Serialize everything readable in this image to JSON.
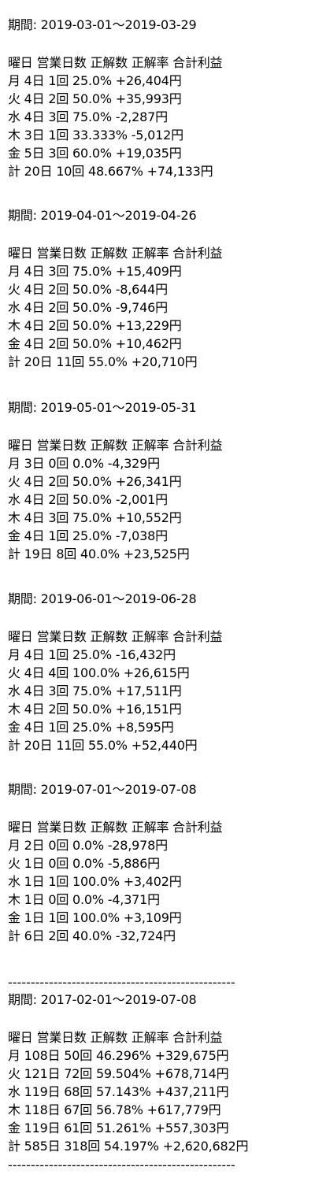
{
  "lines": [
    "期間: 2019-03-01～2019-03-29",
    "曜日 営業日数 正解数 正解率 合計利益",
    "月 4日 1回 25.0% +26,404円",
    "火 4日 2回 50.0% +35,993円",
    "水 4日 3回 75.0% -2,287円",
    "木 3日 1回 33.333% -5,012円",
    "金 5日 3回 60.0% +19,035円",
    "計 20日 10回 48.667% +74,133円",
    "期間: 2019-04-01～2019-04-26",
    "曜日 営業日数 正解数 正解率 合計利益",
    "月 4日 3回 75.0% +15,409円",
    "火 4日 2回 50.0% -8,644円",
    "水 4日 2回 50.0% -9,746円",
    "木 4日 2回 50.0% +13,229円",
    "金 4日 2回 50.0% +10,462円",
    "計 20日 11回 55.0% +20,710円",
    "期間: 2019-05-01～2019-05-31",
    "曜日 営業日数 正解数 正解率 合計利益",
    "月 3日 0回 0.0% -4,329円",
    "火 4日 2回 50.0% +26,341円",
    "水 4日 2回 50.0% -2,001円",
    "木 4日 3回 75.0% +10,552円",
    "金 4日 1回 25.0% -7,038円",
    "計 19日 8回 40.0% +23,525円",
    "期間: 2019-06-01～2019-06-28",
    "曜日 営業日数 正解数 正解率 合計利益",
    "月 4日 1回 25.0% -16,432円",
    "火 4日 4回 100.0% +26,615円",
    "水 4日 3回 75.0% +17,511円",
    "木 4日 2回 50.0% +16,151円",
    "金 4日 1回 25.0% +8,595円",
    "計 20日 11回 55.0% +52,440円",
    "期間: 2019-07-01～2019-07-08",
    "曜日 営業日数 正解数 正解率 合計利益",
    "月 2日 0回 0.0% -28,978円",
    "火 1日 0回 0.0% -5,886円",
    "水 1日 1回 100.0% +3,402円",
    "木 1日 0回 0.0% -4,371円",
    "金 1日 1回 100.0% +3,109円",
    "計 6日 2回 40.0% -32,724円",
    "--------------------------------------------------",
    "期間: 2017-02-01～2019-07-08",
    "曜日 営業日数 正解数 正解率 合計利益",
    "月 108日 50回 46.296% +329,675円",
    "火 121日 72回 59.504% +678,714円",
    "水 119日 68回 57.143% +437,211円",
    "木 118日 67回 56.78% +617,779円",
    "金 119日 61回 51.261% +557,303円",
    "計 585日 318回 54.197% +2,620,682円",
    "--------------------------------------------------"
  ]
}
